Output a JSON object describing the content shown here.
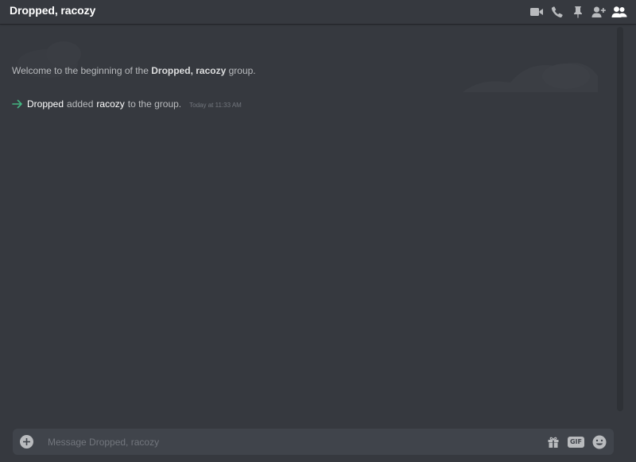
{
  "header": {
    "title": "Dropped, racozy"
  },
  "welcome": {
    "prefix": "Welcome to the beginning of the",
    "group_name": "Dropped, racozy",
    "suffix": "group."
  },
  "system_message": {
    "actor": "Dropped",
    "action": "added",
    "target": "racozy",
    "suffix": "to the group.",
    "timestamp": "Today at 11:33 AM"
  },
  "composer": {
    "placeholder": "Message Dropped, racozy",
    "gif_label": "GIF"
  },
  "icons": {
    "header": [
      "video-call-icon",
      "voice-call-icon",
      "pin-icon",
      "add-friend-icon",
      "members-icon"
    ],
    "composer": [
      "attach-icon",
      "gift-icon",
      "gif-icon",
      "emoji-icon"
    ]
  },
  "colors": {
    "background": "#36393f",
    "composer_bg": "#40444b",
    "arrow_green": "#43b581",
    "text_muted": "#72767d",
    "text_normal": "#b9bbbe",
    "text_white": "#ffffff"
  }
}
